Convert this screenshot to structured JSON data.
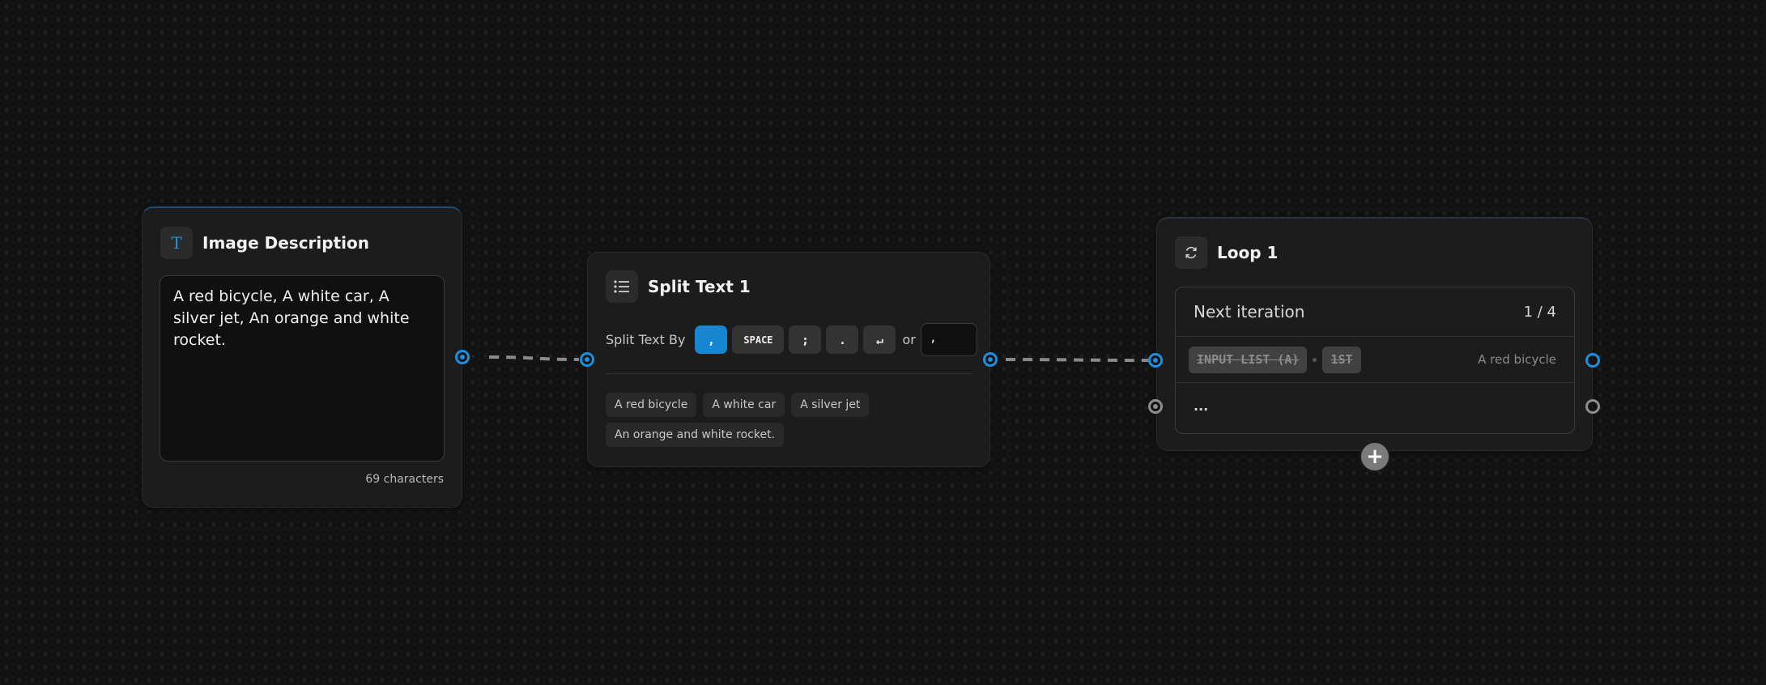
{
  "colors": {
    "canvas_background": "#141414",
    "node_background": "#1c1c1c",
    "accent_blue": "#1786d0",
    "port_blue": "#1b90df",
    "port_gray": "#8d8d8d",
    "edge": "#8a8a8a"
  },
  "nodes": {
    "image_description": {
      "icon": "text-type-icon",
      "icon_glyph": "T",
      "title": "Image Description",
      "text": "A red bicycle, A white car, A silver jet, An orange and white rocket.",
      "char_count": "69 characters"
    },
    "split_text": {
      "icon": "list-icon",
      "title": "Split Text 1",
      "split_label": "Split Text By",
      "delimiters": [
        {
          "label": ",",
          "active": true
        },
        {
          "label": "SPACE",
          "active": false
        },
        {
          "label": ";",
          "active": false
        },
        {
          "label": ".",
          "active": false
        },
        {
          "label": "↵",
          "active": false
        }
      ],
      "or_label": "or",
      "custom_delimiter": ",",
      "items": [
        "A red bicycle",
        "A white car",
        "A silver jet",
        "An orange and white rocket."
      ]
    },
    "loop": {
      "icon": "loop-icon",
      "title": "Loop 1",
      "next_iteration_label": "Next iteration",
      "iteration": "1 / 4",
      "tag_input": "INPUT LIST (A)",
      "tag_index": "1ST",
      "current_item": "A red bicycle",
      "more": "...",
      "add_label": "+"
    }
  }
}
